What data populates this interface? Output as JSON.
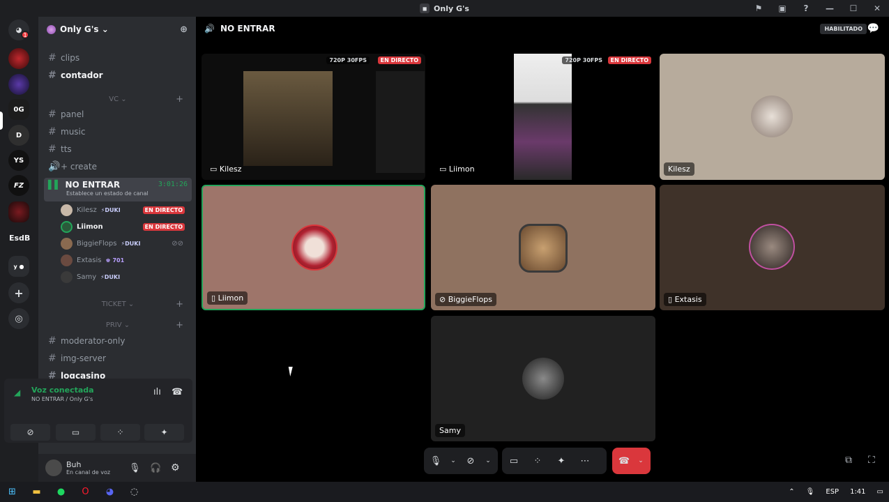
{
  "window": {
    "title": "Only G's"
  },
  "guilds": {
    "text_label": "EsdB",
    "badge": "1"
  },
  "server": {
    "name": "Only G's ⌄"
  },
  "channels": [
    {
      "name": "clips",
      "bright": false
    },
    {
      "name": "contador",
      "bright": true
    },
    {
      "name": "panel",
      "bright": false
    },
    {
      "name": "music",
      "bright": false
    },
    {
      "name": "tts",
      "bright": false
    }
  ],
  "categories": {
    "vc": "VC ⌄",
    "ticket": "TICKET ⌄",
    "priv": "PRIV ⌄"
  },
  "create_label": "+ create",
  "voice_channel": {
    "name": "NO ENTRAR",
    "time": "3:01:26",
    "status": "Establece un estado de canal"
  },
  "members": [
    {
      "name": "Kilesz",
      "tag": "⚡DUKI",
      "live": "EN DIRECTO"
    },
    {
      "name": "Liimon",
      "tag": "",
      "live": "EN DIRECTO"
    },
    {
      "name": "BiggieFlops",
      "tag": "⚡DUKI",
      "live": ""
    },
    {
      "name": "Extasis",
      "tag": "701",
      "live": ""
    },
    {
      "name": "Samy",
      "tag": "⚡DUKI",
      "live": ""
    }
  ],
  "channels2": [
    {
      "name": "moderator-only"
    },
    {
      "name": "img-server"
    },
    {
      "name": "logcasino"
    }
  ],
  "voice_panel": {
    "title": "Voz conectada",
    "sub": "NO ENTRAR / Only G's"
  },
  "user": {
    "name": "Buh",
    "status": "En canal de voz"
  },
  "main": {
    "title": "NO ENTRAR",
    "habilitado": "HABILITADO"
  },
  "tiles": [
    {
      "name": "Kilesz",
      "quality": "720P 30FPS",
      "live": "EN DIRECTO"
    },
    {
      "name": "Liimon",
      "quality": "720P 30FPS",
      "live": "EN DIRECTO"
    },
    {
      "name": "Kilesz"
    },
    {
      "name": "Liimon"
    },
    {
      "name": "BiggieFlops"
    },
    {
      "name": "Extasis"
    },
    {
      "name": "Samy"
    }
  ],
  "taskbar": {
    "lang": "ESP",
    "time": "1:41"
  },
  "colors": {
    "accent_green": "#23a55a",
    "live_red": "#da373c",
    "hangup": "#da373c"
  }
}
